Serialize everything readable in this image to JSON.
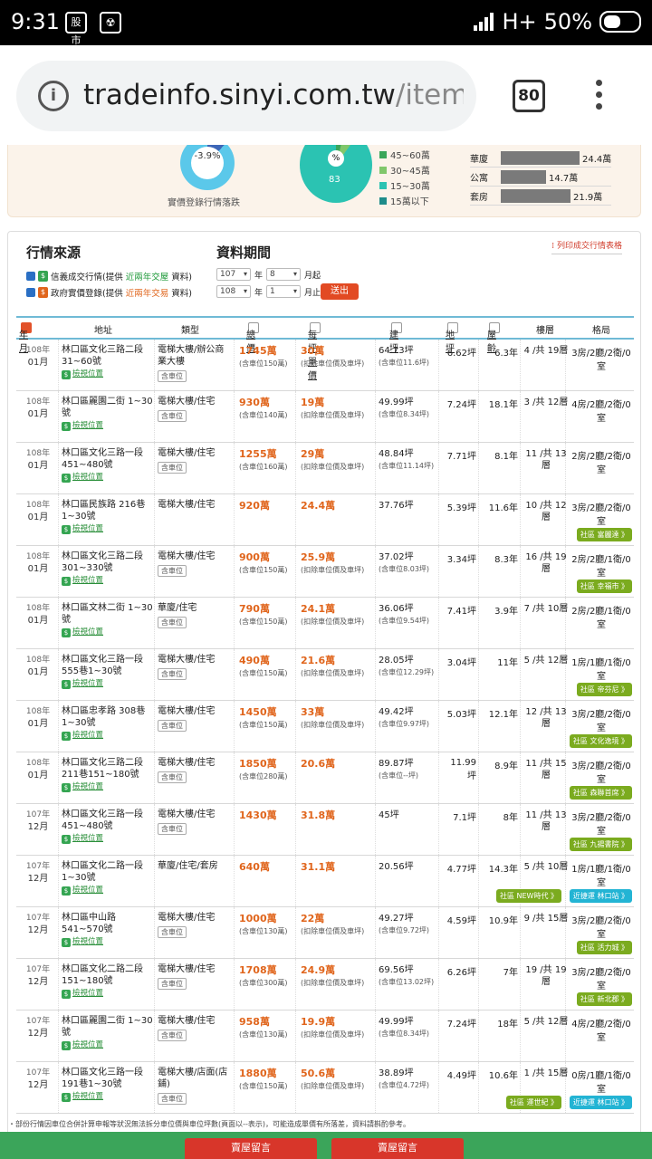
{
  "status_bar": {
    "time": "9:31",
    "app_icon_1": "股市",
    "app_icon_2": "☢",
    "network": "H+",
    "battery": "50%"
  },
  "browser": {
    "url_host": "tradeinfo.sinyi.com.tw",
    "url_path": "/itemL",
    "tab_count": "80"
  },
  "summary": {
    "donut_value": "-3.9%",
    "donut_caption": "實價登錄行情落跌",
    "pie_center": "%",
    "pie_value_main": "83",
    "pie_value_top": "15",
    "legend": [
      {
        "label": "45~60萬",
        "color": "#3aa65a"
      },
      {
        "label": "30~45萬",
        "color": "#80c76b"
      },
      {
        "label": "15~30萬",
        "color": "#2bc3b2"
      },
      {
        "label": "15萬以下",
        "color": "#1d8c8a"
      }
    ],
    "bars": [
      {
        "label": "華廈",
        "value": "24.4萬",
        "level": 0.97
      },
      {
        "label": "公寓",
        "value": "14.7萬",
        "level": 0.56
      },
      {
        "label": "套房",
        "value": "21.9萬",
        "level": 0.86
      }
    ]
  },
  "filters": {
    "source_title": "行情來源",
    "period_title": "資料期間",
    "print_link": "列印成交行情表格",
    "opt1": {
      "prefix": "信義成交行情(提供",
      "highlight": "近兩年交屋",
      "suffix": "資料)"
    },
    "opt2": {
      "prefix": "政府實價登錄(提供",
      "highlight": "近兩年交易",
      "suffix": "資料)"
    },
    "from": {
      "year": "107",
      "month": "8",
      "year_unit": "年",
      "end": "月起"
    },
    "to": {
      "year": "108",
      "month": "1",
      "year_unit": "年",
      "end": "月止"
    },
    "submit": "送出"
  },
  "table": {
    "headers": [
      "年月",
      "地址",
      "類型",
      "總價",
      "每坪單價",
      "建坪",
      "地坪",
      "屋齡",
      "樓層",
      "格局"
    ],
    "view_location": "檢視位置",
    "parking": "含車位",
    "rows": [
      {
        "year": "108年",
        "month": "01月",
        "addr": "林口區文化三路二段 31~60號",
        "type": "電梯大樓/辦公商業大樓",
        "park": true,
        "total": "1745萬",
        "total_note": "(含車位150萬)",
        "unit": "30萬",
        "unit_note": "(扣除車位價及車坪)",
        "area": "64.73坪",
        "area_note": "(含車位11.6坪)",
        "land": "6.62坪",
        "age": "6.3年",
        "floor": "4 /共 19層",
        "plan": "3房/2廳/2衛/0室",
        "tags": []
      },
      {
        "year": "108年",
        "month": "01月",
        "addr": "林口區麗園二街 1~30號",
        "type": "電梯大樓/住宅",
        "park": true,
        "total": "930萬",
        "total_note": "(含車位140萬)",
        "unit": "19萬",
        "unit_note": "(扣除車位價及車坪)",
        "area": "49.99坪",
        "area_note": "(含車位8.34坪)",
        "land": "7.24坪",
        "age": "18.1年",
        "floor": "3 /共 12層",
        "plan": "4房/2廳/2衛/0室",
        "tags": []
      },
      {
        "year": "108年",
        "month": "01月",
        "addr": "林口區文化三路一段 451~480號",
        "type": "電梯大樓/住宅",
        "park": true,
        "total": "1255萬",
        "total_note": "(含車位160萬)",
        "unit": "29萬",
        "unit_note": "(扣除車位價及車坪)",
        "area": "48.84坪",
        "area_note": "(含車位11.14坪)",
        "land": "7.71坪",
        "age": "8.1年",
        "floor": "11 /共 13層",
        "plan": "2房/2廳/2衛/0室",
        "tags": []
      },
      {
        "year": "108年",
        "month": "01月",
        "addr": "林口區民族路 216巷1~30號",
        "type": "電梯大樓/住宅",
        "park": false,
        "total": "920萬",
        "total_note": "",
        "unit": "24.4萬",
        "unit_note": "",
        "area": "37.76坪",
        "area_note": "",
        "land": "5.39坪",
        "age": "11.6年",
        "floor": "10 /共 12層",
        "plan": "3房/2廳/2衛/0室",
        "tags": [
          {
            "text": "社區 富麗達 》",
            "kind": "g"
          }
        ]
      },
      {
        "year": "108年",
        "month": "01月",
        "addr": "林口區文化三路二段 301~330號",
        "type": "電梯大樓/住宅",
        "park": true,
        "total": "900萬",
        "total_note": "(含車位150萬)",
        "unit": "25.9萬",
        "unit_note": "(扣除車位價及車坪)",
        "area": "37.02坪",
        "area_note": "(含車位8.03坪)",
        "land": "3.34坪",
        "age": "8.3年",
        "floor": "16 /共 19層",
        "plan": "2房/2廳/1衛/0室",
        "tags": [
          {
            "text": "社區 幸福市 》",
            "kind": "g"
          }
        ]
      },
      {
        "year": "108年",
        "month": "01月",
        "addr": "林口區文林二街 1~30號",
        "type": "華廈/住宅",
        "park": true,
        "total": "790萬",
        "total_note": "(含車位150萬)",
        "unit": "24.1萬",
        "unit_note": "(扣除車位價及車坪)",
        "area": "36.06坪",
        "area_note": "(含車位9.54坪)",
        "land": "7.41坪",
        "age": "3.9年",
        "floor": "7 /共 10層",
        "plan": "2房/2廳/1衛/0室",
        "tags": []
      },
      {
        "year": "108年",
        "month": "01月",
        "addr": "林口區文化三路一段 555巷1~30號",
        "type": "電梯大樓/住宅",
        "park": true,
        "total": "490萬",
        "total_note": "(含車位150萬)",
        "unit": "21.6萬",
        "unit_note": "(扣除車位價及車坪)",
        "area": "28.05坪",
        "area_note": "(含車位12.29坪)",
        "land": "3.04坪",
        "age": "11年",
        "floor": "5 /共 12層",
        "plan": "1房/1廳/1衛/0室",
        "tags": [
          {
            "text": "社區 帝芬尼 》",
            "kind": "g"
          }
        ]
      },
      {
        "year": "108年",
        "month": "01月",
        "addr": "林口區忠孝路 308巷1~30號",
        "type": "電梯大樓/住宅",
        "park": true,
        "total": "1450萬",
        "total_note": "(含車位150萬)",
        "unit": "33萬",
        "unit_note": "(扣除車位價及車坪)",
        "area": "49.42坪",
        "area_note": "(含車位9.97坪)",
        "land": "5.03坪",
        "age": "12.1年",
        "floor": "12 /共 13層",
        "plan": "3房/2廳/2衛/0室",
        "tags": [
          {
            "text": "社區 文化逸境 》",
            "kind": "g"
          }
        ]
      },
      {
        "year": "108年",
        "month": "01月",
        "addr": "林口區文化三路二段 211巷151~180號",
        "type": "電梯大樓/住宅",
        "park": true,
        "total": "1850萬",
        "total_note": "(含車位280萬)",
        "unit": "20.6萬",
        "unit_note": "",
        "area": "89.87坪",
        "area_note": "(含車位--坪)",
        "land": "11.99坪",
        "age": "8.9年",
        "floor": "11 /共 15層",
        "plan": "3房/2廳/2衛/0室",
        "tags": [
          {
            "text": "社區 森聯首席 》",
            "kind": "g"
          }
        ]
      },
      {
        "year": "107年",
        "month": "12月",
        "addr": "林口區文化三路一段 451~480號",
        "type": "電梯大樓/住宅",
        "park": true,
        "total": "1430萬",
        "total_note": "",
        "unit": "31.8萬",
        "unit_note": "",
        "area": "45坪",
        "area_note": "",
        "land": "7.1坪",
        "age": "8年",
        "floor": "11 /共 13層",
        "plan": "3房/2廳/2衛/0室",
        "tags": [
          {
            "text": "社區 九揚書院 》",
            "kind": "g"
          }
        ]
      },
      {
        "year": "107年",
        "month": "12月",
        "addr": "林口區文化二路一段 1~30號",
        "type": "華廈/住宅/套房",
        "park": false,
        "total": "640萬",
        "total_note": "",
        "unit": "31.1萬",
        "unit_note": "",
        "area": "20.56坪",
        "area_note": "",
        "land": "4.77坪",
        "age": "14.3年",
        "floor": "5 /共 10層",
        "plan": "1房/1廳/1衛/0室",
        "tags": [
          {
            "text": "社區 NEW時代 》",
            "kind": "g"
          },
          {
            "text": "近捷運 林口站 》",
            "kind": "b"
          }
        ]
      },
      {
        "year": "107年",
        "month": "12月",
        "addr": "林口區中山路 541~570號",
        "type": "電梯大樓/住宅",
        "park": true,
        "total": "1000萬",
        "total_note": "(含車位130萬)",
        "unit": "22萬",
        "unit_note": "(扣除車位價及車坪)",
        "area": "49.27坪",
        "area_note": "(含車位9.72坪)",
        "land": "4.59坪",
        "age": "10.9年",
        "floor": "9 /共 15層",
        "plan": "3房/2廳/2衛/0室",
        "tags": [
          {
            "text": "社區 活力城 》",
            "kind": "g"
          }
        ]
      },
      {
        "year": "107年",
        "month": "12月",
        "addr": "林口區文化二路二段 151~180號",
        "type": "電梯大樓/住宅",
        "park": true,
        "total": "1708萬",
        "total_note": "(含車位300萬)",
        "unit": "24.9萬",
        "unit_note": "(扣除車位價及車坪)",
        "area": "69.56坪",
        "area_note": "(含車位13.02坪)",
        "land": "6.26坪",
        "age": "7年",
        "floor": "19 /共 19層",
        "plan": "3房/2廳/2衛/0室",
        "tags": [
          {
            "text": "社區 新北郡 》",
            "kind": "g"
          }
        ]
      },
      {
        "year": "107年",
        "month": "12月",
        "addr": "林口區麗園二街 1~30號",
        "type": "電梯大樓/住宅",
        "park": true,
        "total": "958萬",
        "total_note": "(含車位130萬)",
        "unit": "19.9萬",
        "unit_note": "(扣除車位價及車坪)",
        "area": "49.99坪",
        "area_note": "(含車位8.34坪)",
        "land": "7.24坪",
        "age": "18年",
        "floor": "5 /共 12層",
        "plan": "4房/2廳/2衛/0室",
        "tags": []
      },
      {
        "year": "107年",
        "month": "12月",
        "addr": "林口區文化三路一段 191巷1~30號",
        "type": "電梯大樓/店面(店鋪)",
        "park": true,
        "total": "1880萬",
        "total_note": "(含車位150萬)",
        "unit": "50.6萬",
        "unit_note": "(扣除車位價及車坪)",
        "area": "38.89坪",
        "area_note": "(含車位4.72坪)",
        "land": "4.49坪",
        "age": "10.6年",
        "floor": "1 /共 15層",
        "plan": "0房/1廳/1衛/0室",
        "tags": [
          {
            "text": "社區 運世紀 》",
            "kind": "g"
          },
          {
            "text": "近捷運 林口站 》",
            "kind": "b"
          }
        ]
      }
    ]
  },
  "footnote": "・部份行情因車位合併計算申報等狀況無法拆分車位價與車位坪數(頁面以--表示)，可能造成單價有所落差，資料請斟酌參考。",
  "bottom_buttons": [
    "賣屋留言",
    "賣屋留言"
  ],
  "colors": {
    "price": "#e0651c",
    "header_line": "#6fbad6",
    "tag_green": "#7bab1f",
    "tag_blue": "#23b4d4",
    "submit": "#e24a23"
  }
}
